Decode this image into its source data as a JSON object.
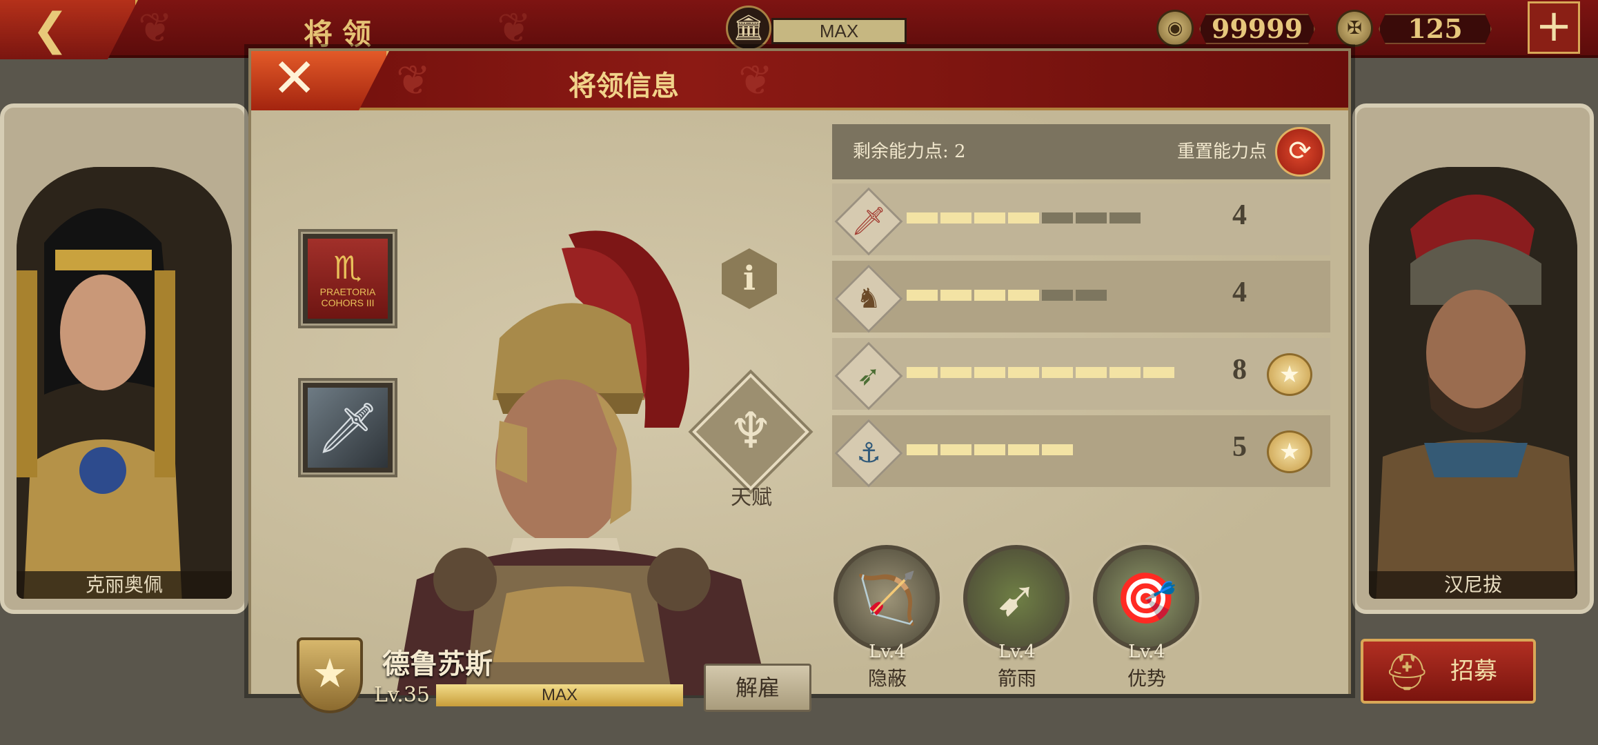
{
  "topbar": {
    "page_title": "将领",
    "temple_status": "MAX",
    "coins": "99999",
    "spqr_count": "125",
    "icons": {
      "back": "back-arrow-icon",
      "temple": "temple-icon",
      "coin": "coin-icon",
      "spqr": "spqr-eagle-icon",
      "add": "plus-icon"
    }
  },
  "background_heroes": {
    "left_name": "克丽奥佩",
    "right_name": "汉尼拔"
  },
  "recruit": {
    "label": "招募"
  },
  "modal": {
    "title": "将领信息",
    "equipment": {
      "banner_text": "PRAETORIA COHORS III",
      "slots": [
        "banner-icon",
        "sword-icon"
      ]
    },
    "talent_label": "天赋",
    "general": {
      "name": "德鲁苏斯",
      "level_text": "Lv.35",
      "exp_text": "MAX",
      "dismiss_label": "解雇"
    },
    "points": {
      "remaining_text": "剩余能力点: 2",
      "reset_label": "重置能力点"
    },
    "stats": [
      {
        "icon": "sword-icon",
        "value": "4",
        "filled": 4,
        "max": 7
      },
      {
        "icon": "horse-icon",
        "value": "4",
        "filled": 4,
        "max": 6
      },
      {
        "icon": "bow-icon",
        "value": "8",
        "filled": 8,
        "max": 8,
        "badge": true
      },
      {
        "icon": "anchor-icon",
        "value": "5",
        "filled": 5,
        "max": 5,
        "badge": true
      }
    ],
    "skills": [
      {
        "level": "Lv.4",
        "name": "隐蔽",
        "icon": "ambush-icon",
        "color": "#9d9478"
      },
      {
        "level": "Lv.4",
        "name": "箭雨",
        "icon": "arrow-rain-icon",
        "color": "#6f7f45"
      },
      {
        "level": "Lv.4",
        "name": "优势",
        "icon": "archers-icon",
        "color": "#8f9a6a"
      }
    ]
  }
}
